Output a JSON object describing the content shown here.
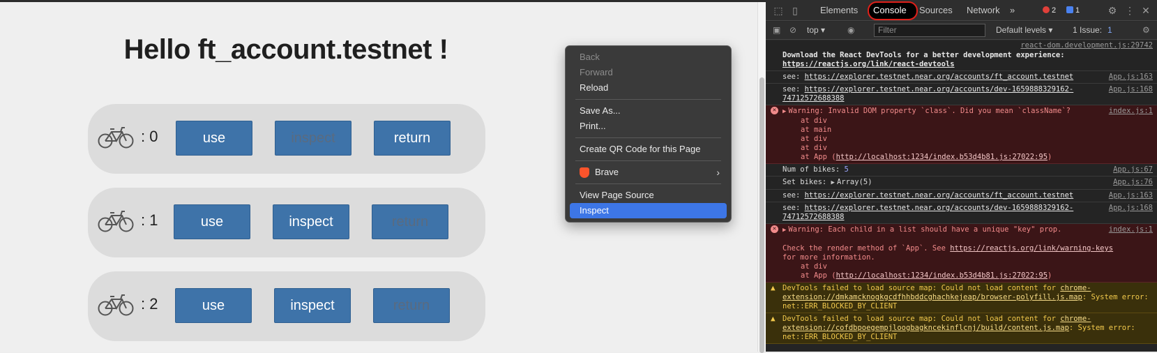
{
  "page": {
    "title": "Hello ft_account.testnet !",
    "bikes": [
      {
        "num": ": 0",
        "use": "use",
        "inspect": "inspect",
        "return": "return"
      },
      {
        "num": ": 1",
        "use": "use",
        "inspect": "inspect",
        "return": "return"
      },
      {
        "num": ": 2",
        "use": "use",
        "inspect": "inspect",
        "return": "return"
      }
    ]
  },
  "context_menu": {
    "back": "Back",
    "forward": "Forward",
    "reload": "Reload",
    "save_as": "Save As...",
    "print": "Print...",
    "qr": "Create QR Code for this Page",
    "brave": "Brave",
    "view_source": "View Page Source",
    "inspect": "Inspect"
  },
  "devtools": {
    "tabs": {
      "elements": "Elements",
      "console": "Console",
      "sources": "Sources",
      "network": "Network",
      "more": "»"
    },
    "error_count": "2",
    "message_count": "1",
    "filterbar": {
      "context": "top ▾",
      "filter_placeholder": "Filter",
      "levels": "Default levels ▾",
      "issues": "1 Issue:",
      "issue_count": "1"
    },
    "log": {
      "r1_src": "react-dom.development.js:29742",
      "r1_text": "Download the React DevTools for a better development experience: ",
      "r1_link": "https://reactjs.org/link/react-devtools",
      "r2_text": "see: ",
      "r2_link": "https://explorer.testnet.near.org/accounts/ft_account.testnet",
      "r2_src": "App.js:163",
      "r3_text": "see: ",
      "r3_link": "https://explorer.testnet.near.org/accounts/dev-1659888329162-74712572688388",
      "r3_src": "App.js:168",
      "r4_text": "Warning: Invalid DOM property `class`. Did you mean `className`?",
      "r4_src": "index.js:1",
      "r4_at1": "at div",
      "r4_at2": "at main",
      "r4_at3": "at div",
      "r4_at4": "at div",
      "r4_at5_pre": "at App (",
      "r4_at5_link": "http://localhost:1234/index.b53d4b81.js:27022:95",
      "r4_at5_post": ")",
      "r5_text": "Num of bikes: ",
      "r5_num": "5",
      "r5_src": "App.js:67",
      "r6_text": "Set bikes: ",
      "r6_arr": "Array(5)",
      "r6_src": "App.js:76",
      "r7_text": "see: ",
      "r7_link": "https://explorer.testnet.near.org/accounts/ft_account.testnet",
      "r7_src": "App.js:163",
      "r8_text": "see: ",
      "r8_link": "https://explorer.testnet.near.org/accounts/dev-1659888329162-74712572688388",
      "r8_src": "App.js:168",
      "r9_text": "Warning: Each child in a list should have a unique \"key\" prop.",
      "r9_src": "index.js:1",
      "r9_line2_pre": "Check the render method of `App`. See ",
      "r9_line2_link": "https://reactjs.org/link/warning-keys",
      "r9_line3": "for more information.",
      "r9_at1": "at div",
      "r9_at2_pre": "at App (",
      "r9_at2_link": "http://localhost:1234/index.b53d4b81.js:27022:95",
      "r9_at2_post": ")",
      "r10_pre": "DevTools failed to load source map: Could not load content for ",
      "r10_link": "chrome-extension://dmkamcknogkgcdfhhbddcghachkejeap/browser-polyfill.js.map",
      "r10_post": ": System error: net::ERR_BLOCKED_BY_CLIENT",
      "r11_pre": "DevTools failed to load source map: Could not load content for ",
      "r11_link": "chrome-extension://cofdbpoegempjloogbagkncekinflcnj/build/content.js.map",
      "r11_post": ": System error: net::ERR_BLOCKED_BY_CLIENT"
    }
  },
  "colors": {
    "button_blue": "#3e73a9",
    "menu_selected": "#3d76e6",
    "console_highlight": "#e0201a",
    "error_bg": "#3b1517",
    "warn_bg": "#3a300b"
  }
}
